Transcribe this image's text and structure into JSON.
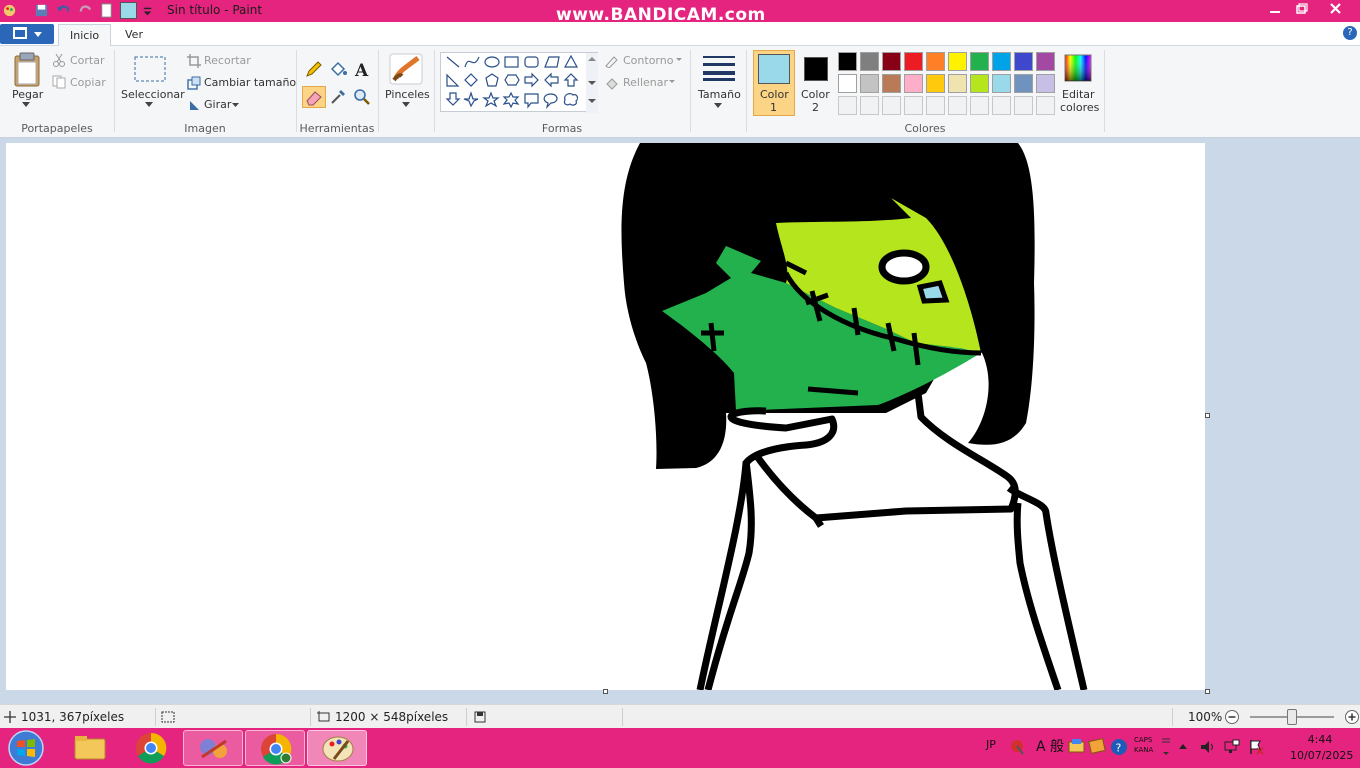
{
  "titlebar": {
    "title": "Sin título - Paint",
    "watermark": "www.BANDICAM.com"
  },
  "tabs": {
    "inicio": "Inicio",
    "ver": "Ver"
  },
  "ribbon": {
    "portapapeles": {
      "label": "Portapapeles",
      "pegar": "Pegar",
      "cortar": "Cortar",
      "copiar": "Copiar"
    },
    "imagen": {
      "label": "Imagen",
      "seleccionar": "Seleccionar",
      "recortar": "Recortar",
      "cambiar_tamano": "Cambiar tamaño",
      "girar": "Girar"
    },
    "herramientas": {
      "label": "Herramientas"
    },
    "pinceles": "Pinceles",
    "formas": {
      "label": "Formas",
      "contorno": "Contorno",
      "rellenar": "Rellenar"
    },
    "tamano": "Tamaño",
    "color1": {
      "line1": "Color",
      "line2": "1",
      "value": "#99d9ea"
    },
    "color2": {
      "line1": "Color",
      "line2": "2",
      "value": "#000000"
    },
    "colores": {
      "label": "Colores",
      "editar_line1": "Editar",
      "editar_line2": "colores",
      "palette_row1": [
        "#000000",
        "#7f7f7f",
        "#880015",
        "#ed1c24",
        "#ff7f27",
        "#fff200",
        "#22b14c",
        "#00a2e8",
        "#3f48cc",
        "#a349a4"
      ],
      "palette_row2": [
        "#ffffff",
        "#c3c3c3",
        "#b97a57",
        "#ffaec9",
        "#ffc90e",
        "#efe4b0",
        "#b5e61d",
        "#99d9ea",
        "#7092be",
        "#c8bfe7"
      ]
    }
  },
  "drawing_colors": {
    "hair": "#000000",
    "face_dark": "#22b14c",
    "face_light": "#b5e61d",
    "eye_pupil": "#99d9ea"
  },
  "status": {
    "cursor_pos": "1031, 367píxeles",
    "canvas_size": "1200 × 548píxeles",
    "zoom": "100%"
  },
  "taskbar": {
    "lang": "JP",
    "ime": "A 般",
    "caps": "CAPS",
    "kana": "KANA",
    "time": "4:44",
    "date": "10/07/2025"
  }
}
